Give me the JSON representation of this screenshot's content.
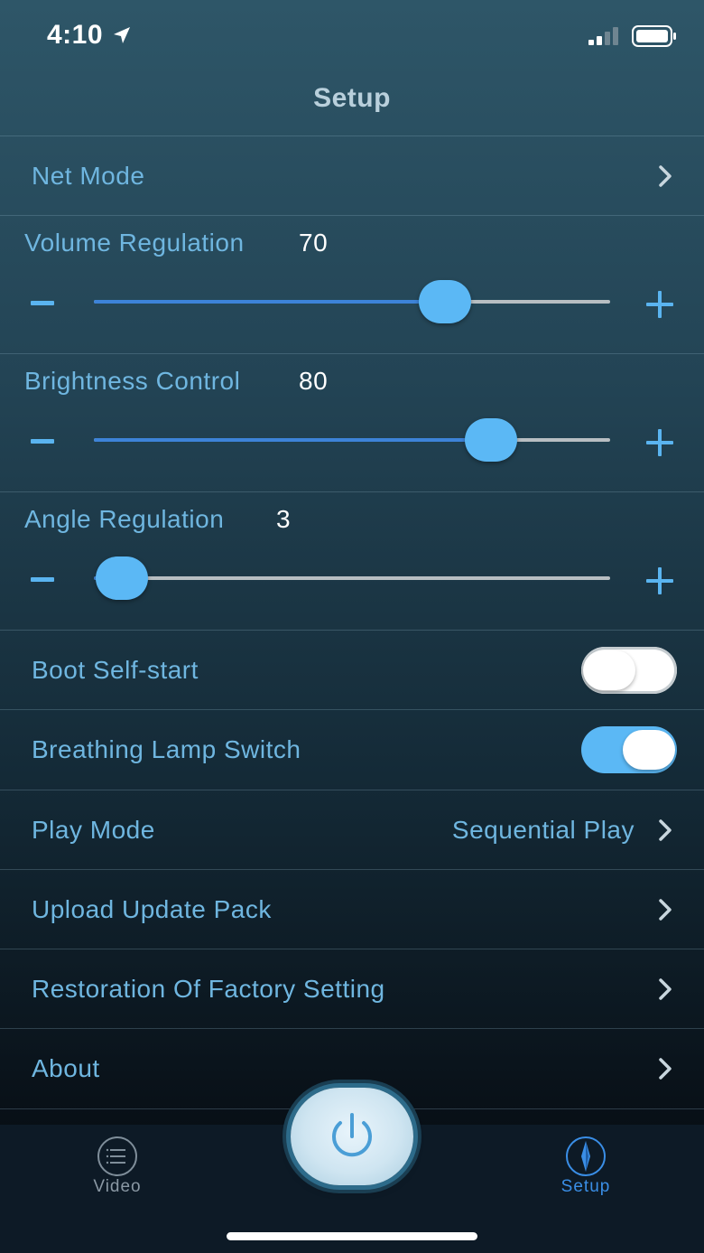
{
  "status_bar": {
    "time": "4:10"
  },
  "nav": {
    "title": "Setup"
  },
  "net_mode": {
    "label": "Net Mode"
  },
  "sliders": [
    {
      "id": "volume",
      "label": "Volume Regulation",
      "value": "70",
      "fraction": 0.68
    },
    {
      "id": "brightness",
      "label": "Brightness Control",
      "value": "80",
      "fraction": 0.77
    },
    {
      "id": "angle",
      "label": "Angle Regulation",
      "value": "3",
      "fraction": 0.055
    }
  ],
  "toggles": {
    "boot_self_start": {
      "label": "Boot Self-start",
      "on": false
    },
    "breathing_lamp": {
      "label": "Breathing Lamp Switch",
      "on": true
    }
  },
  "play_mode": {
    "label": "Play Mode",
    "value": "Sequential Play"
  },
  "upload": {
    "label": "Upload Update Pack"
  },
  "restore": {
    "label": "Restoration Of Factory Setting"
  },
  "about": {
    "label": "About"
  },
  "tabbar": {
    "video": {
      "label": "Video",
      "icon": "list-icon",
      "color": "#8a98a4"
    },
    "setup": {
      "label": "Setup",
      "icon": "compass-icon",
      "color": "#3a8ee6"
    },
    "power": {
      "icon": "power-icon"
    }
  },
  "colors": {
    "accent": "#5bb8f5",
    "label": "#6fb6e0",
    "track_fill": "#3d83d8"
  }
}
